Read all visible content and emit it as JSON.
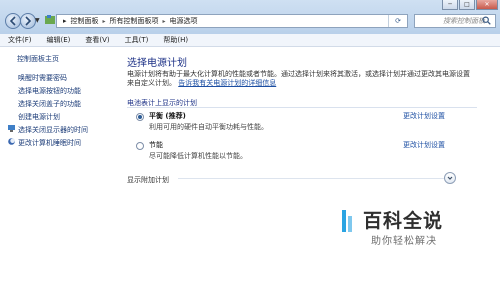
{
  "window": {
    "minimize": "─",
    "maximize": "□",
    "close": "✕"
  },
  "nav": {
    "back_icon": "arrow-left",
    "forward_icon": "arrow-right",
    "dropdown": "▼"
  },
  "address": {
    "sep": "▸",
    "crumbs": [
      "控制面板",
      "所有控制面板项",
      "电源选项"
    ],
    "refresh": "⟳"
  },
  "search": {
    "placeholder": "搜索控制面板",
    "icon": "search-icon"
  },
  "menubar": [
    "文件(F)",
    "编辑(E)",
    "查看(V)",
    "工具(T)",
    "帮助(H)"
  ],
  "leftnav": {
    "home": "控制面板主页",
    "items": [
      "唤醒时需要密码",
      "选择电源按钮的功能",
      "选择关闭盖子的功能",
      "创建电源计划",
      "选择关闭显示器的时间",
      "更改计算机睡眠时间"
    ]
  },
  "main": {
    "title": "选择电源计划",
    "desc_line1": "电源计划将有助于最大化计算机的性能或者节能。通过选择计划来将其激活，或选择计划并通过更改其电源设置",
    "desc_line2_prefix": "来自定义计划。",
    "desc_link": "告诉我有关电源计划的详细信息",
    "section": "电池表计上显示的计划",
    "plans": [
      {
        "name": "平衡 (推荐)",
        "desc": "利用可用的硬件自动平衡功耗与性能。",
        "selected": true,
        "change": "更改计划设置"
      },
      {
        "name": "节能",
        "desc": "尽可能降低计算机性能以节能。",
        "selected": false,
        "change": "更改计划设置"
      }
    ],
    "additional": "显示附加计划",
    "expand": "⌄"
  },
  "watermark": {
    "title": "百科全说",
    "subtitle": "助你轻松解决"
  },
  "colors": {
    "link": "#1d4fa3",
    "heading": "#1e3287",
    "watermark_accent": "#2aa4e2"
  }
}
